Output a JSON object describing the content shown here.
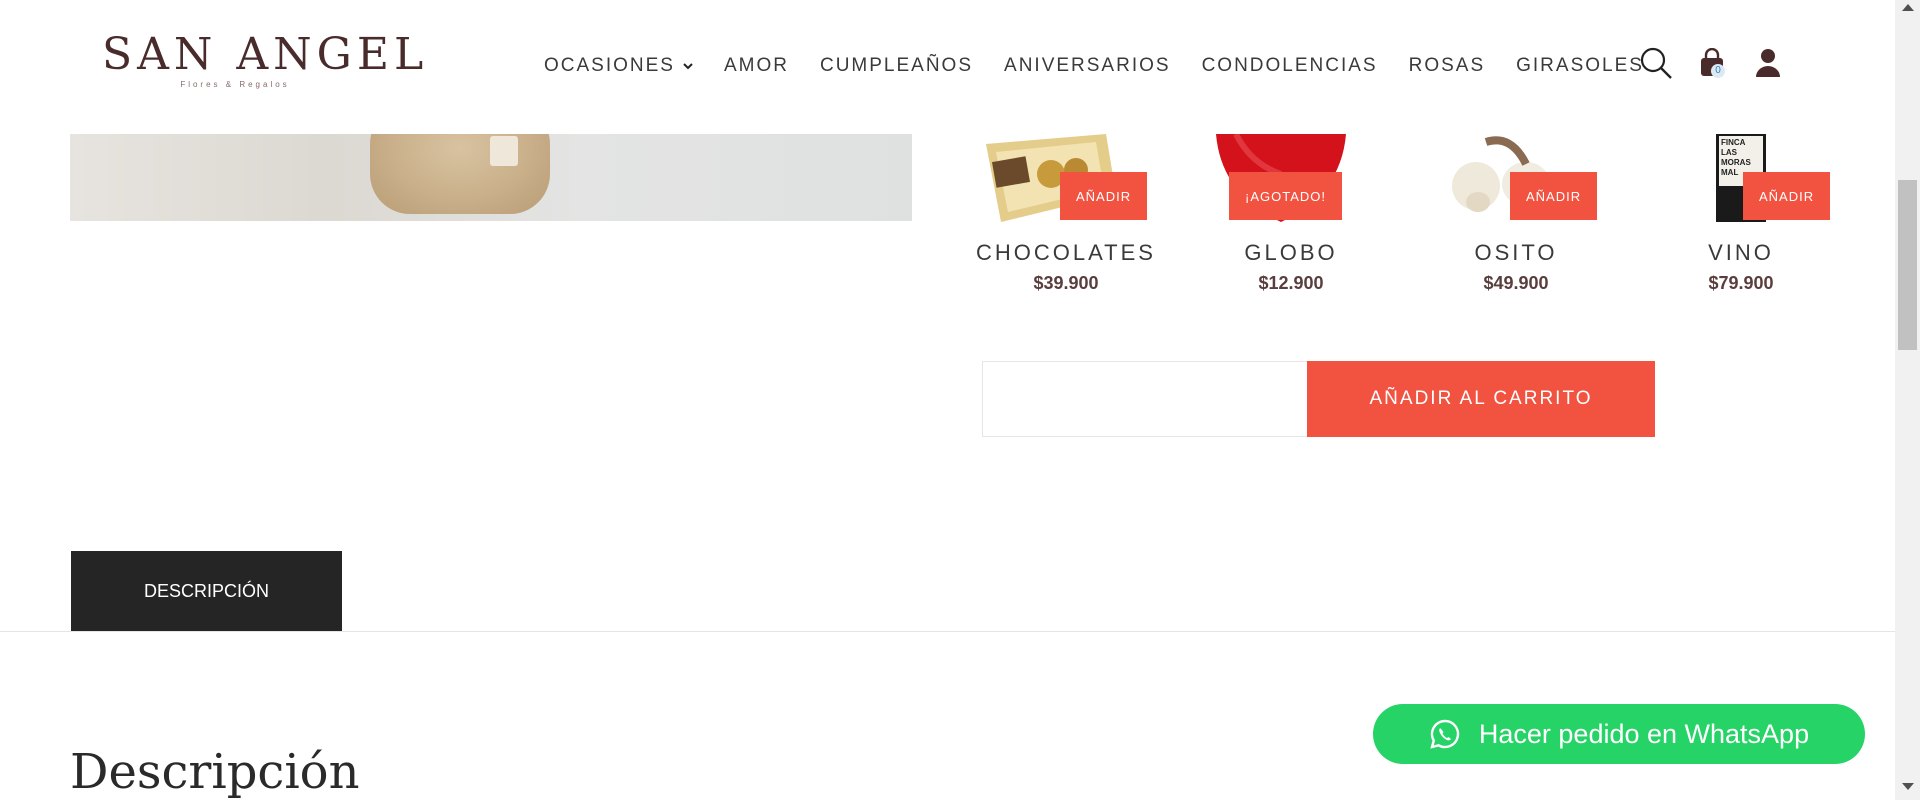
{
  "brand": {
    "name": "SAN ANGEL",
    "tagline": "Flores & Regalos",
    "color": "#4a2b2b"
  },
  "nav": {
    "items": [
      {
        "label": "OCASIONES",
        "has_dropdown": true
      },
      {
        "label": "AMOR"
      },
      {
        "label": "CUMPLEAÑOS"
      },
      {
        "label": "ANIVERSARIOS"
      },
      {
        "label": "CONDOLENCIAS"
      },
      {
        "label": "ROSAS"
      },
      {
        "label": "GIRASOLES"
      }
    ],
    "icons": [
      "search-icon",
      "cart-icon",
      "user-icon"
    ],
    "cart_count": "0"
  },
  "addons": [
    {
      "name": "CHOCOLATES",
      "price": "$39.900",
      "button": "AÑADIR",
      "thumb": "chocolates-box"
    },
    {
      "name": "GLOBO",
      "price": "$12.900",
      "button": "¡AGOTADO!",
      "thumb": "red-heart-balloon"
    },
    {
      "name": "OSITO",
      "price": "$49.900",
      "button": "AÑADIR",
      "thumb": "teddy-bear"
    },
    {
      "name": "VINO",
      "price": "$79.900",
      "button": "AÑADIR",
      "thumb": "wine-bottle",
      "bottle_text": "FINCA LAS MORAS MAL"
    }
  ],
  "cart": {
    "quantity_value": "",
    "add_label": "AÑADIR AL CARRITO"
  },
  "tabs": {
    "active": "DESCRIPCIÓN"
  },
  "description": {
    "title": "Descripción"
  },
  "whatsapp": {
    "label": "Hacer pedido en WhatsApp",
    "color": "#25d366"
  },
  "colors": {
    "accent": "#f25341",
    "tab_bg": "#252525"
  }
}
